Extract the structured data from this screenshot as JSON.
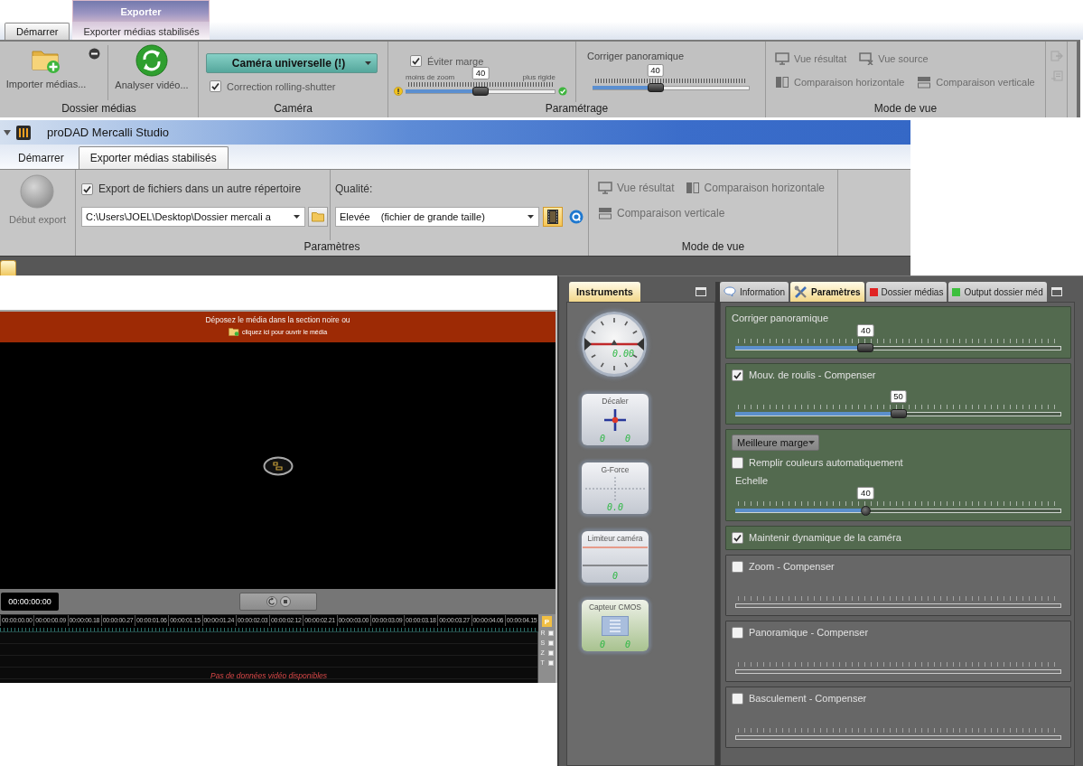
{
  "ribbon_start": {
    "context_tab": "Exporter",
    "tabs": [
      {
        "label": "Démarrer",
        "selected": true
      },
      {
        "label": "Exporter médias stabilisés",
        "selected": false
      }
    ],
    "media_group": {
      "label": "Dossier médias",
      "import_button": "Importer médias...",
      "analyze_button": "Analyser vidéo..."
    },
    "camera_group": {
      "label": "Caméra",
      "camera_dropdown": "Caméra universelle (!)",
      "rolling_shutter": {
        "label": "Correction rolling-shutter",
        "checked": true
      }
    },
    "settings_group": {
      "label": "Paramétrage",
      "avoid_margin": {
        "label": "Éviter marge",
        "checked": true
      },
      "zoom_slider": {
        "min_label": "moins de zoom",
        "max_label": "plus rigide",
        "value": "40",
        "level": 0.5
      },
      "pan_slider": {
        "label": "Corriger panoramique",
        "value": "40",
        "level": 0.4
      }
    },
    "view_group": {
      "label": "Mode de vue",
      "buttons": [
        {
          "kind": "result",
          "label": "Vue résultat",
          "disabled": true
        },
        {
          "kind": "source",
          "label": "Vue source",
          "disabled": true
        },
        {
          "kind": "horizontal",
          "label": "Comparaison horizontale",
          "disabled": true
        },
        {
          "kind": "vertical",
          "label": "Comparaison verticale",
          "disabled": true
        }
      ]
    }
  },
  "studio_window": {
    "title": "proDAD Mercalli Studio",
    "tabs": [
      {
        "label": "Démarrer",
        "selected": false
      },
      {
        "label": "Exporter médias stabilisés",
        "selected": true
      }
    ],
    "export_button": {
      "label": "Début export",
      "disabled": true
    },
    "params_group": {
      "label": "Paramètres",
      "export_other_folder": {
        "label": "Export de fichiers dans un autre répertoire",
        "checked": true
      },
      "path_dropdown": "C:\\Users\\JOEL\\Desktop\\Dossier mercali a",
      "quality_label": "Qualité:",
      "quality_dropdown": "Elevée    (fichier de grande taille)",
      "format_buttons": [
        {
          "kind": "film",
          "selected": true
        },
        {
          "kind": "ring",
          "selected": false
        }
      ]
    },
    "view_group": {
      "label": "Mode de vue",
      "buttons": [
        {
          "kind": "result",
          "label": "Vue résultat",
          "disabled": true
        },
        {
          "kind": "horizontal",
          "label": "Comparaison horizontale",
          "disabled": true
        },
        {
          "kind": "vertical",
          "label": "Comparaison verticale",
          "disabled": true
        }
      ]
    }
  },
  "player": {
    "drop_message": "Déposez le média dans la section noire ou",
    "open_link": "cliquez ici pour ouvrir le média",
    "timecode": "00:00:00:00",
    "timeline": {
      "ticks": [
        "00:00:00.00",
        "00:00:00.09",
        "00:00:00.18",
        "00:00:00.27",
        "00:00:01.06",
        "00:00:01.15",
        "00:00:01.24",
        "00:00:02.03",
        "00:00:02.12",
        "00:00:02.21",
        "00:00:03.00",
        "00:00:03.09",
        "00:00:03.18",
        "00:00:03.27",
        "00:00:04.06",
        "00:00:04.15"
      ],
      "marker": "P",
      "track_flags": [
        "R",
        "S",
        "Z",
        "T"
      ],
      "empty_message": "Pas de données vidéo disponibles"
    }
  },
  "instruments": {
    "tab": {
      "label": "Instruments",
      "selected": true
    },
    "gauges": [
      {
        "kind": "dial",
        "readings": [
          "0.00"
        ]
      },
      {
        "kind": "crosshair",
        "title": "Décaler",
        "readings": [
          "0",
          "0"
        ]
      },
      {
        "kind": "grid",
        "title": "G-Force",
        "readings": [
          "0.0"
        ]
      },
      {
        "kind": "limiter",
        "title": "Limiteur caméra",
        "readings": [
          "0"
        ]
      },
      {
        "kind": "sensor",
        "title": "Capteur CMOS",
        "readings": [
          "0",
          "0"
        ]
      }
    ]
  },
  "settings_panel": {
    "tabs": [
      {
        "kind": "info",
        "label": "Information",
        "selected": false
      },
      {
        "kind": "tools",
        "label": "Paramètres",
        "selected": true
      },
      {
        "kind": "folder",
        "label": "Dossier médias",
        "selected": false,
        "color": "#e02424"
      },
      {
        "kind": "folder",
        "label": "Output dossier méd",
        "selected": false,
        "color": "#3cbf3c"
      }
    ],
    "sections": [
      {
        "kind": "slider",
        "label": "Corriger panoramique",
        "value": "40",
        "level": 0.4
      },
      {
        "kind": "toggle-slider",
        "label": "Mouv. de roulis - Compenser",
        "checked": true,
        "value": "50",
        "level": 0.5
      },
      {
        "kind": "margin",
        "dropdown": "Meilleure marge",
        "autofill": {
          "label": "Remplir couleurs automatiquement",
          "checked": false
        },
        "scale_label": "Echelle",
        "value": "40",
        "level": 0.4
      },
      {
        "kind": "toggle",
        "label": "Maintenir dynamique de la caméra",
        "checked": true
      },
      {
        "kind": "toggle-slider",
        "label": "Zoom - Compenser",
        "checked": false
      },
      {
        "kind": "toggle-slider",
        "label": "Panoramique - Compenser",
        "checked": false
      },
      {
        "kind": "toggle-slider",
        "label": "Basculement - Compenser",
        "checked": false
      }
    ]
  }
}
